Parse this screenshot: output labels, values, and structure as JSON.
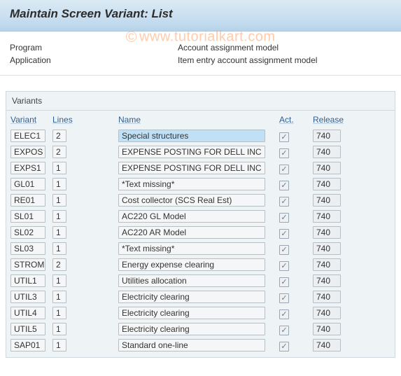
{
  "title": "Maintain Screen Variant: List",
  "watermark": {
    "copy": "©",
    "text": "www.tutorialkart.com"
  },
  "header": {
    "program_label": "Program",
    "program_value": "Account assignment model",
    "application_label": "Application",
    "application_value": "Item entry account assignment model"
  },
  "section_title": "Variants",
  "columns": {
    "variant": "Variant",
    "lines": "Lines",
    "name": "Name",
    "act": "Act.",
    "release": "Release"
  },
  "rows": [
    {
      "variant": "ELEC1",
      "lines": "2",
      "name": "Special structures",
      "act": true,
      "release": "740",
      "selected": true
    },
    {
      "variant": "EXPOS",
      "lines": "2",
      "name": "EXPENSE POSTING FOR DELL INC",
      "act": true,
      "release": "740"
    },
    {
      "variant": "EXPS1",
      "lines": "1",
      "name": "EXPENSE POSTING FOR DELL INC",
      "act": true,
      "release": "740"
    },
    {
      "variant": "GL01",
      "lines": "1",
      "name": "*Text missing*",
      "act": true,
      "release": "740"
    },
    {
      "variant": "RE01",
      "lines": "1",
      "name": "Cost collector (SCS Real Est)",
      "act": true,
      "release": "740"
    },
    {
      "variant": "SL01",
      "lines": "1",
      "name": "AC220 GL Model",
      "act": true,
      "release": "740"
    },
    {
      "variant": "SL02",
      "lines": "1",
      "name": "AC220  AR  Model",
      "act": true,
      "release": "740"
    },
    {
      "variant": "SL03",
      "lines": "1",
      "name": "*Text missing*",
      "act": true,
      "release": "740"
    },
    {
      "variant": "STROM",
      "lines": "2",
      "name": "Energy expense clearing",
      "act": true,
      "release": "740"
    },
    {
      "variant": "UTIL1",
      "lines": "1",
      "name": "Utilities allocation",
      "act": true,
      "release": "740"
    },
    {
      "variant": "UTIL3",
      "lines": "1",
      "name": "Electricity clearing",
      "act": true,
      "release": "740"
    },
    {
      "variant": "UTIL4",
      "lines": "1",
      "name": "Electricity clearing",
      "act": true,
      "release": "740"
    },
    {
      "variant": "UTIL5",
      "lines": "1",
      "name": "Electricity clearing",
      "act": true,
      "release": "740"
    },
    {
      "variant": "SAP01",
      "lines": "1",
      "name": "Standard one-line",
      "act": true,
      "release": "740"
    }
  ]
}
